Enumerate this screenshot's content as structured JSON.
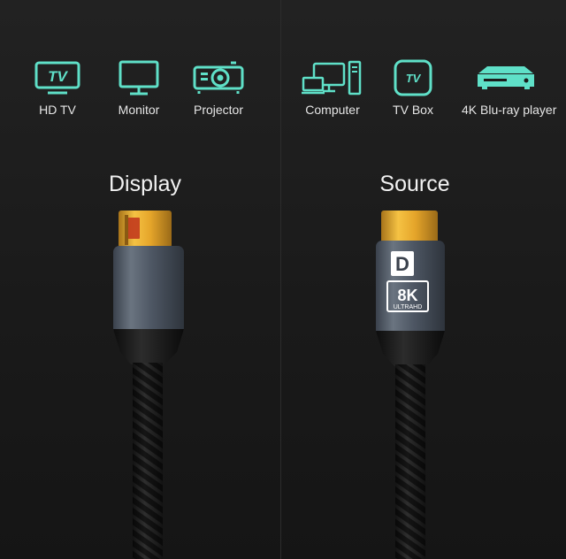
{
  "left": {
    "devices": [
      {
        "label": "HD TV",
        "icon": "tv-icon",
        "icon_text": "TV"
      },
      {
        "label": "Monitor",
        "icon": "monitor-icon"
      },
      {
        "label": "Projector",
        "icon": "projector-icon"
      }
    ],
    "heading": "Display"
  },
  "right": {
    "devices": [
      {
        "label": "Computer",
        "icon": "computer-icon"
      },
      {
        "label": "TV Box",
        "icon": "tv-box-icon",
        "icon_text": "TV"
      },
      {
        "label": "4K Blu-ray player",
        "icon": "blu-ray-player-icon"
      }
    ],
    "heading": "Source",
    "connector_badge": {
      "logo": "D",
      "big": "8K",
      "small": "ULTRAHD"
    }
  },
  "colors": {
    "icon": "#5fe0c8",
    "gold": "#e0a82a",
    "shell": "#4a5260",
    "background": "#1b1b1b"
  }
}
